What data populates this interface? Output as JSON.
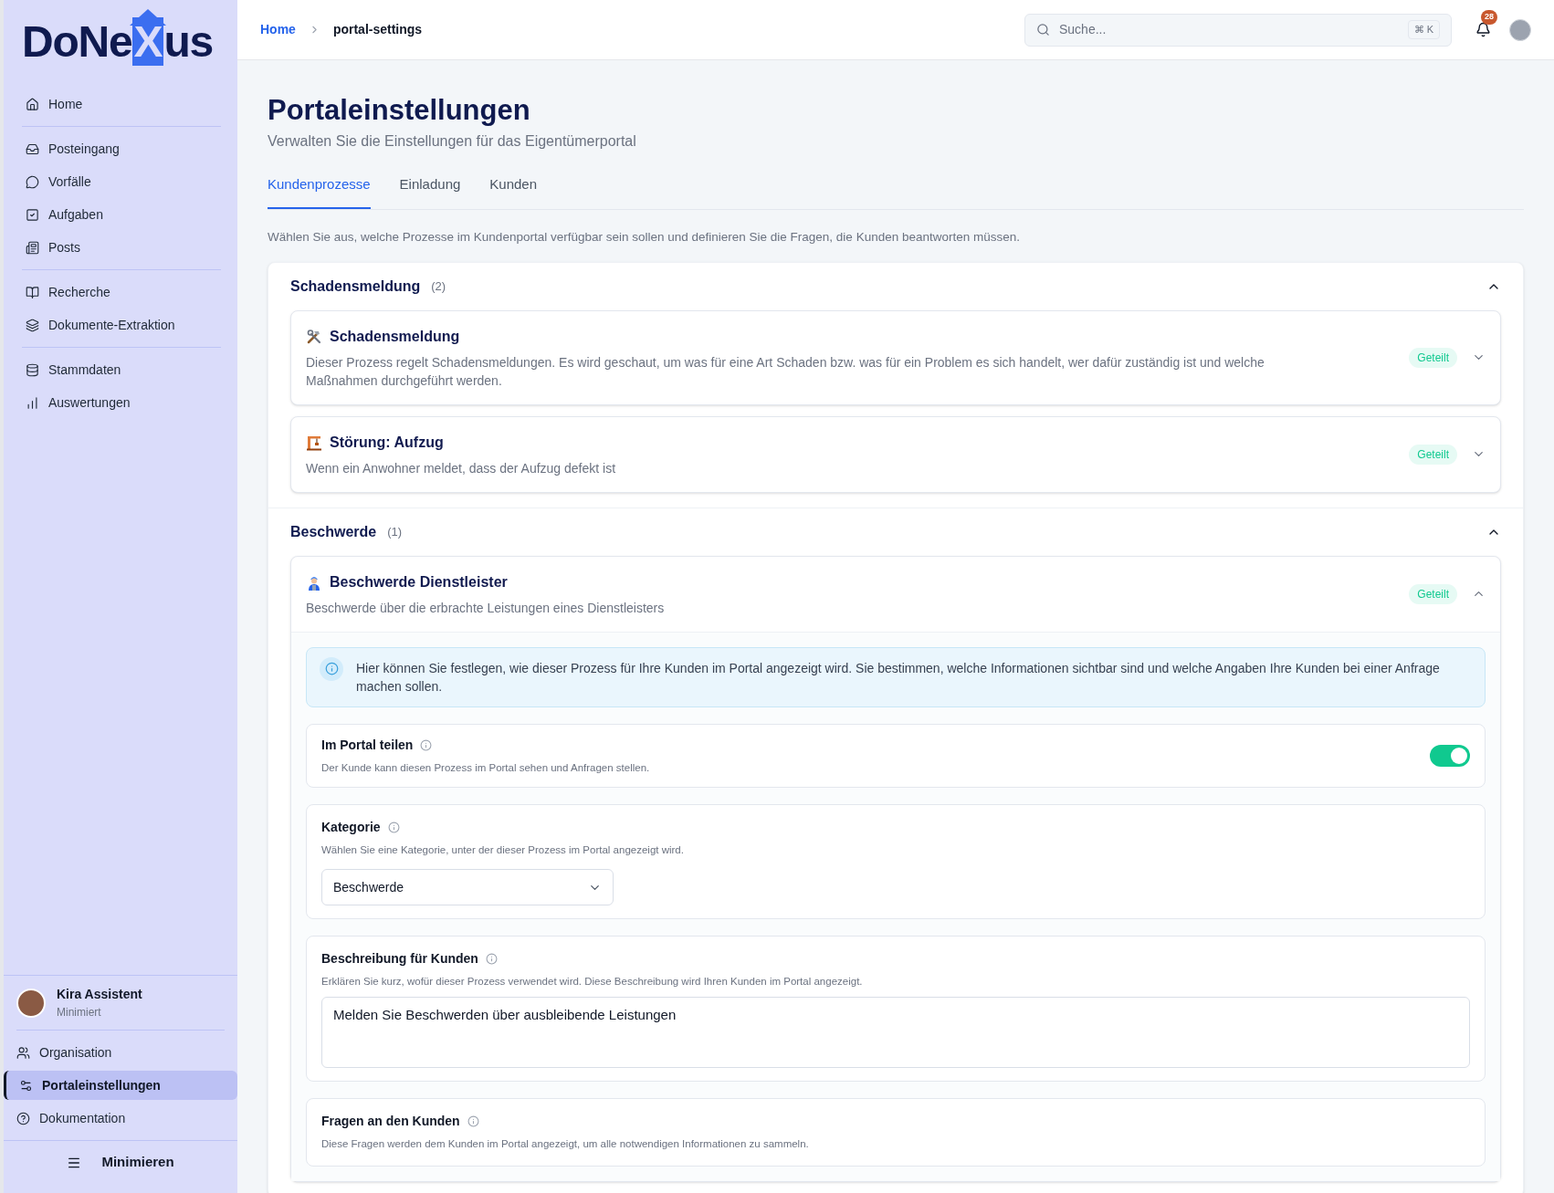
{
  "sidebar": {
    "logo": {
      "before": "DoNe",
      "highlight": "X",
      "after": "us"
    },
    "groups": [
      [
        {
          "label": "Home",
          "selected": false
        }
      ],
      [
        {
          "label": "Posteingang",
          "selected": false
        },
        {
          "label": "Vorfälle",
          "selected": false
        },
        {
          "label": "Aufgaben",
          "selected": false
        },
        {
          "label": "Posts",
          "selected": false
        }
      ],
      [
        {
          "label": "Recherche",
          "selected": false
        },
        {
          "label": "Dokumente-Extraktion",
          "selected": false
        }
      ],
      [
        {
          "label": "Stammdaten",
          "selected": false
        },
        {
          "label": "Auswertungen",
          "selected": false
        }
      ]
    ],
    "user": {
      "name": "Kira Assistent",
      "status": "Minimiert"
    },
    "bottom_items": [
      {
        "label": "Organisation",
        "selected": false
      },
      {
        "label": "Portaleinstellungen",
        "selected": true
      },
      {
        "label": "Dokumentation",
        "selected": false
      }
    ],
    "collapse": "Minimieren"
  },
  "topbar": {
    "breadcrumbs": [
      "Home",
      "portal-settings"
    ],
    "search": {
      "placeholder": "Suche...",
      "shortcut": "⌘ K"
    },
    "notifications": "28"
  },
  "page": {
    "title": "Portaleinstellungen",
    "subtitle": "Verwalten Sie die Einstellungen für das Eigentümerportal",
    "tabs": [
      {
        "label": "Kundenprozesse",
        "selected": true
      },
      {
        "label": "Einladung",
        "selected": false
      },
      {
        "label": "Kunden",
        "selected": false
      }
    ],
    "intro": "Wählen Sie aus, welche Prozesse im Kundenportal verfügbar sein sollen und definieren Sie die Fragen, die Kunden beantworten müssen.",
    "sections": [
      {
        "title": "Schadensmeldung",
        "count": "(2)",
        "expanded": true,
        "processes": [
          {
            "title": "Schadensmeldung",
            "description": "Dieser Prozess regelt Schadensmeldungen. Es wird geschaut, um was für eine Art Schaden bzw. was für ein Problem es sich handelt, wer dafür zuständig ist und welche Maßnahmen durchgeführt werden.",
            "badge": "Geteilt",
            "expanded": false
          },
          {
            "title": "Störung: Aufzug",
            "description": "Wenn ein Anwohner meldet, dass der Aufzug defekt ist",
            "badge": "Geteilt",
            "expanded": false
          }
        ]
      },
      {
        "title": "Beschwerde",
        "count": "(1)",
        "expanded": true,
        "processes": [
          {
            "title": "Beschwerde Dienstleister",
            "description": "Beschwerde über die erbrachte Leistungen eines Dienstleisters",
            "badge": "Geteilt",
            "expanded": true,
            "info": "Hier können Sie festlegen, wie dieser Prozess für Ihre Kunden im Portal angezeigt wird. Sie bestimmen, welche Informationen sichtbar sind und welche Angaben Ihre Kunden bei einer Anfrage machen sollen.",
            "settings": [
              {
                "kind": "toggle",
                "label": "Im Portal teilen",
                "hint": "Der Kunde kann diesen Prozess im Portal sehen und Anfragen stellen.",
                "on": true
              },
              {
                "kind": "select",
                "label": "Kategorie",
                "hint": "Wählen Sie eine Kategorie, unter der dieser Prozess im Portal angezeigt wird.",
                "value": "Beschwerde"
              },
              {
                "kind": "textarea",
                "label": "Beschreibung für Kunden",
                "hint": "Erklären Sie kurz, wofür dieser Prozess verwendet wird. Diese Beschreibung wird Ihren Kunden im Portal angezeigt.",
                "value": "Melden Sie Beschwerden über ausbleibende Leistungen"
              },
              {
                "kind": "plain",
                "label": "Fragen an den Kunden",
                "hint": "Diese Fragen werden dem Kunden im Portal angezeigt, um alle notwendigen Informationen zu sammeln."
              }
            ]
          }
        ]
      }
    ]
  }
}
